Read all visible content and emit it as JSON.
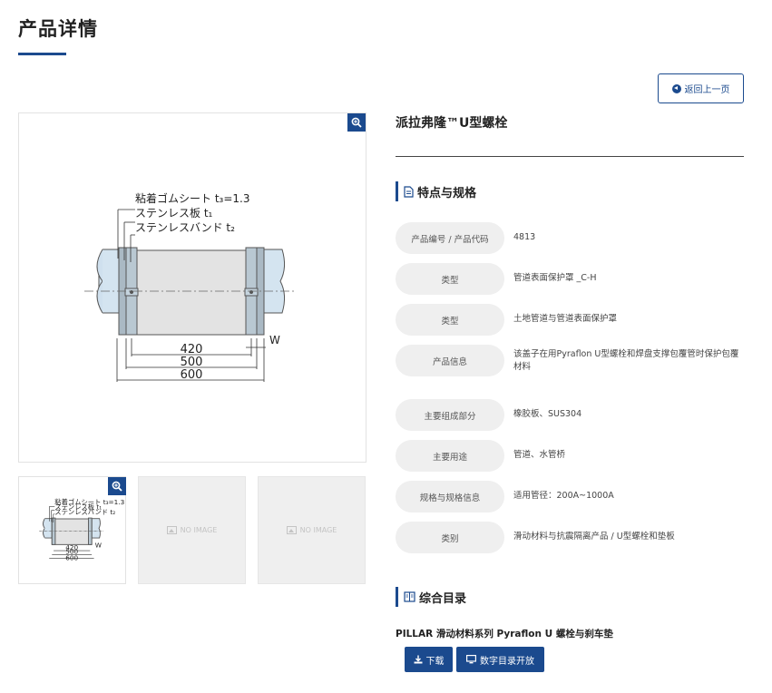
{
  "header": {
    "title": "产品详情"
  },
  "back_button": {
    "label": "返回上一页"
  },
  "product": {
    "title": "派拉弗隆™U型螺栓"
  },
  "diagram": {
    "label_rubber": "粘着ゴムシート t₃=1.3",
    "label_plate": "ステンレス板 t₁",
    "label_band": "ステンレスバンド t₂",
    "dim_inner": "420",
    "dim_middle": "500",
    "dim_outer": "600",
    "dim_w": "W"
  },
  "thumbnails": {
    "no_image_label": "NO IMAGE"
  },
  "specs": {
    "title": "特点与规格",
    "rows": [
      {
        "label": "产品编号 / 产品代码",
        "value": "4813"
      },
      {
        "label": "类型",
        "value": "管道表面保护罩 _C-H"
      },
      {
        "label": "类型",
        "value": "土地管道与管道表面保护罩"
      },
      {
        "label": "产品信息",
        "value": "该盖子在用Pyraflon U型螺栓和焊盘支撑包覆管时保护包覆材料"
      },
      {
        "label": "主要组成部分",
        "value": "橡胶板、SUS304"
      },
      {
        "label": "主要用途",
        "value": "管道、水管桥"
      },
      {
        "label": "规格与规格信息",
        "value": "适用管径：200A~1000A"
      },
      {
        "label": "类别",
        "value": "滑动材料与抗震隔离产品 / U型螺栓和垫板"
      }
    ]
  },
  "catalog": {
    "title": "综合目录",
    "name": "PILLAR 滑动材料系列 Pyraflon U 螺栓与刹车垫",
    "download_label": "下载",
    "open_label": "数字目录开放"
  },
  "icons": {
    "back": "arrow-circle-left-icon",
    "zoom": "zoom-in-icon",
    "document": "document-icon",
    "book": "book-icon",
    "download": "download-icon",
    "monitor": "monitor-icon",
    "no_image": "image-placeholder-icon"
  },
  "colors": {
    "accent": "#1b4a8e",
    "label_bg": "#efefef",
    "placeholder_bg": "#efefef"
  }
}
